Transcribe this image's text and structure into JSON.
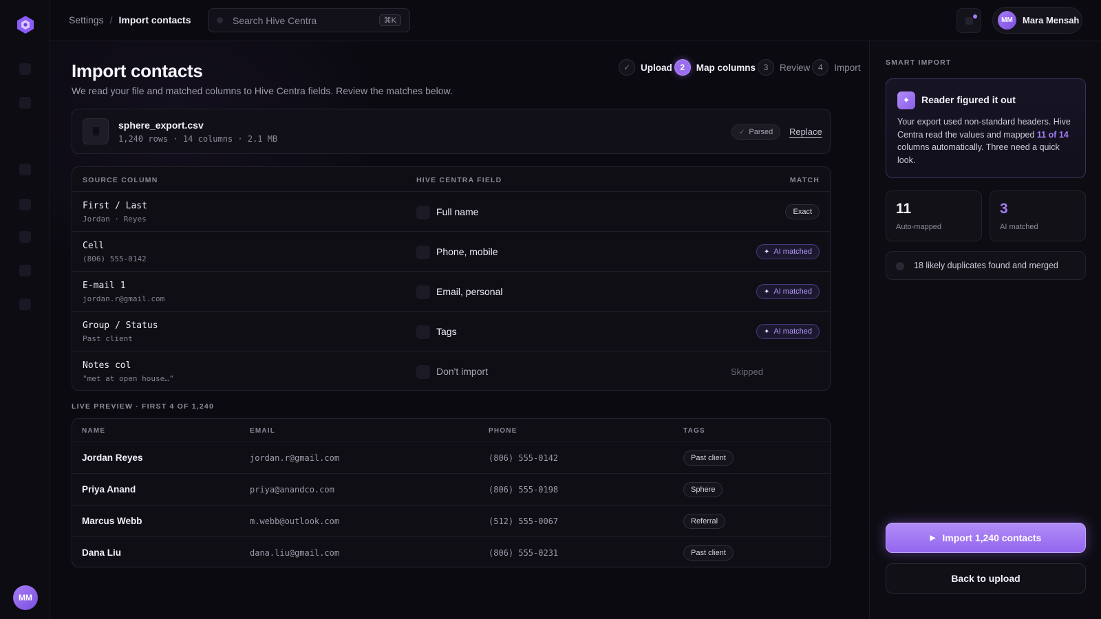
{
  "app": {
    "name": "Hive Centra"
  },
  "breadcrumb": {
    "parent": "Settings",
    "separator": "/",
    "current": "Import contacts"
  },
  "search": {
    "placeholder": "Search Hive Centra",
    "shortcut": "⌘K"
  },
  "user": {
    "initials": "MM",
    "name": "Mara Mensah"
  },
  "page": {
    "title": "Import contacts",
    "subtitle": "We read your file and matched columns to Hive Centra fields. Review the matches below."
  },
  "stepper": [
    {
      "number": "✓",
      "label": "Upload",
      "state": "done"
    },
    {
      "number": "2",
      "label": "Map columns",
      "state": "active"
    },
    {
      "number": "3",
      "label": "Review",
      "state": "pending"
    },
    {
      "number": "4",
      "label": "Import",
      "state": "pending"
    }
  ],
  "file": {
    "name": "sphere_export.csv",
    "meta": "1,240 rows · 14 columns · 2.1 MB",
    "status": "Parsed",
    "replace_label": "Replace"
  },
  "mapping": {
    "headers": {
      "source": "SOURCE COLUMN",
      "field": "HIVE CENTRA FIELD",
      "match": "MATCH"
    },
    "rows": [
      {
        "source": "First / Last",
        "example": "Jordan · Reyes",
        "field": "Full name",
        "match": "Exact",
        "match_type": "exact",
        "field_icon": "user-icon"
      },
      {
        "source": "Cell",
        "example": "(806) 555-0142",
        "field": "Phone, mobile",
        "match": "AI matched",
        "match_type": "ai",
        "field_icon": "phone-icon"
      },
      {
        "source": "E-mail 1",
        "example": "jordan.r@gmail.com",
        "field": "Email, personal",
        "match": "AI matched",
        "match_type": "ai",
        "field_icon": "mail-icon"
      },
      {
        "source": "Group / Status",
        "example": "Past client",
        "field": "Tags",
        "match": "AI matched",
        "match_type": "ai",
        "field_icon": "tag-icon"
      },
      {
        "source": "Notes col",
        "example": "\"met at open house…\"",
        "field": "Don't import",
        "match": "Skipped",
        "match_type": "skipped",
        "field_icon": "ban-icon"
      }
    ]
  },
  "preview": {
    "label": "LIVE PREVIEW · FIRST 4 OF 1,240",
    "headers": {
      "name": "NAME",
      "email": "EMAIL",
      "phone": "PHONE",
      "tags": "TAGS"
    },
    "rows": [
      {
        "name": "Jordan Reyes",
        "email": "jordan.r@gmail.com",
        "phone": "(806) 555-0142",
        "tag": "Past client"
      },
      {
        "name": "Priya Anand",
        "email": "priya@anandco.com",
        "phone": "(806) 555-0198",
        "tag": "Sphere"
      },
      {
        "name": "Marcus Webb",
        "email": "m.webb@outlook.com",
        "phone": "(512) 555-0067",
        "tag": "Referral"
      },
      {
        "name": "Dana Liu",
        "email": "dana.liu@gmail.com",
        "phone": "(806) 555-0231",
        "tag": "Past client"
      }
    ]
  },
  "smart_import": {
    "label": "SMART IMPORT",
    "card_title": "Reader figured it out",
    "card_body_before": "Your export used non-standard headers. Hive Centra read the values and mapped ",
    "card_body_highlight": "11 of 14",
    "card_body_after": " columns automatically. Three need a quick look.",
    "stats": [
      {
        "value": "11",
        "label": "Auto-mapped"
      },
      {
        "value": "3",
        "label": "AI matched"
      }
    ],
    "duplicates": "18 likely duplicates found and merged"
  },
  "actions": {
    "import_label": "Import 1,240 contacts",
    "back_label": "Back to upload"
  },
  "colors": {
    "accent": "#9a6cf0",
    "background": "#0b0a10",
    "ai_text": "#b597f7"
  }
}
